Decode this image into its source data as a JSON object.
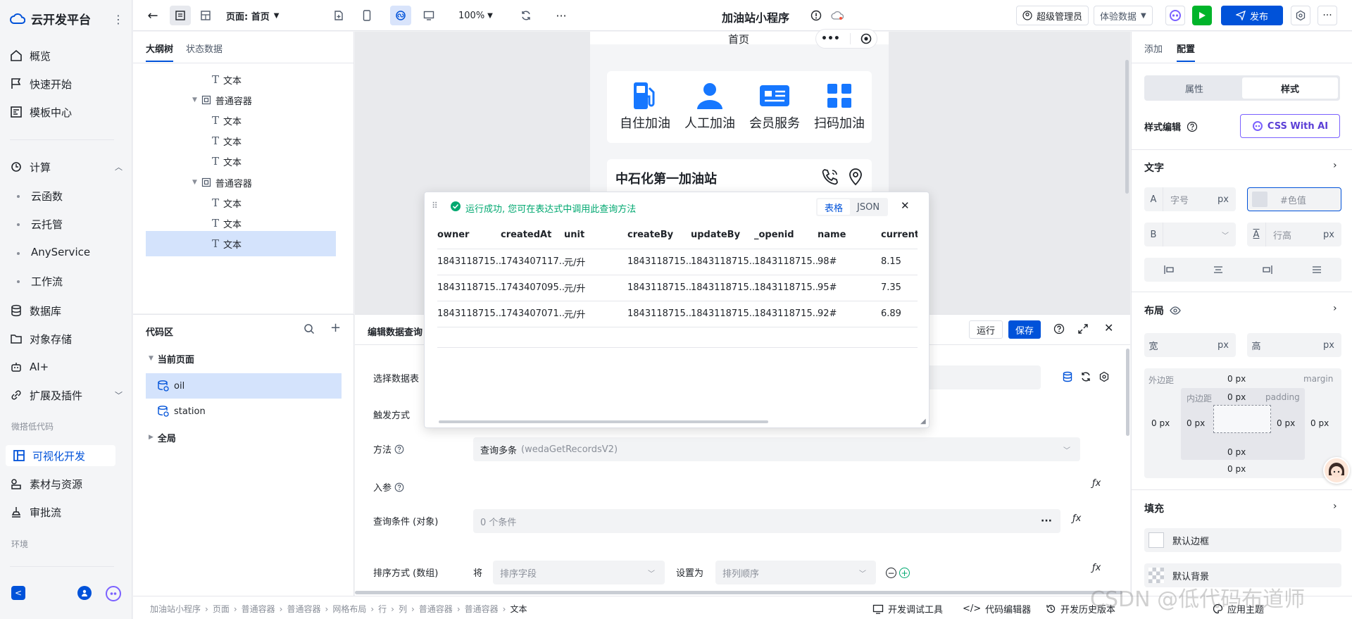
{
  "app": {
    "name": "云开发平台",
    "page_title": "加油站小程序"
  },
  "nav": {
    "items": [
      "概览",
      "快速开始",
      "模板中心"
    ],
    "compute": "计算",
    "compute_sub": [
      "云函数",
      "云托管",
      "AnyService",
      "工作流"
    ],
    "items2": [
      "数据库",
      "对象存储",
      "AI+",
      "扩展及插件"
    ],
    "group_lowcode": "微搭低代码",
    "active": "可视化开发",
    "items3": [
      "素材与资源",
      "审批流"
    ],
    "group_env": "环境"
  },
  "topbar": {
    "page_label": "页面: 首页",
    "zoom": "100%",
    "user": "超级管理员",
    "env": "体验数据",
    "publish": "发布"
  },
  "tree": {
    "tabs": [
      "大纲树",
      "状态数据"
    ],
    "nodes": [
      {
        "label": "文本",
        "type": "text",
        "level": 2
      },
      {
        "label": "普通容器",
        "type": "container",
        "level": 1
      },
      {
        "label": "文本",
        "type": "text",
        "level": 2
      },
      {
        "label": "文本",
        "type": "text",
        "level": 2
      },
      {
        "label": "文本",
        "type": "text",
        "level": 2
      },
      {
        "label": "普通容器",
        "type": "container",
        "level": 1
      },
      {
        "label": "文本",
        "type": "text",
        "level": 2
      },
      {
        "label": "文本",
        "type": "text",
        "level": 2
      },
      {
        "label": "文本",
        "type": "text",
        "level": 2,
        "selected": true
      }
    ]
  },
  "code": {
    "title": "代码区",
    "current_page": "当前页面",
    "items": [
      "oil",
      "station"
    ],
    "global": "全局"
  },
  "phone": {
    "header": "首页",
    "services": [
      "自住加油",
      "人工加油",
      "会员服务",
      "扫码加油"
    ],
    "station_name": "中石化第一加油站"
  },
  "editor": {
    "title": "编辑数据查询",
    "run": "运行",
    "save": "保存",
    "fields": {
      "select_table": "选择数据表",
      "trigger": "触发方式",
      "method": "方法",
      "method_value": "查询多条",
      "method_api": "(wedaGetRecordsV2)",
      "params": "入参",
      "query_cond": "查询条件 (对象)",
      "query_cond_value": "0 个条件",
      "sort": "排序方式 (数组)",
      "sort_will": "将",
      "sort_field_ph": "排序字段",
      "sort_set_as": "设置为",
      "sort_order_ph": "排列顺序"
    }
  },
  "popup": {
    "message": "运行成功, 您可在表达式中调用此查询方法",
    "tabs": [
      "表格",
      "JSON"
    ],
    "columns": [
      "owner",
      "createdAt",
      "unit",
      "createBy",
      "updateBy",
      "_openid",
      "name",
      "current_"
    ],
    "rows": [
      [
        "1843118715...",
        "1743407117...",
        "元/升",
        "1843118715...",
        "1843118715...",
        "1843118715...",
        "98#",
        "8.15"
      ],
      [
        "1843118715...",
        "1743407095...",
        "元/升",
        "1843118715...",
        "1843118715...",
        "1843118715...",
        "95#",
        "7.35"
      ],
      [
        "1843118715...",
        "1743407071...",
        "元/升",
        "1843118715...",
        "1843118715...",
        "1843118715...",
        "92#",
        "6.89"
      ]
    ]
  },
  "right": {
    "tabs": [
      "添加",
      "配置"
    ],
    "seg": [
      "属性",
      "样式"
    ],
    "style_edit": "样式编辑",
    "css_ai": "CSS With AI",
    "text_section": "文字",
    "font_size_ph": "字号",
    "px": "px",
    "color_ph": "#色值",
    "line_height_ph": "行高",
    "layout_section": "布局",
    "width": "宽",
    "height": "高",
    "outer_margin": "外边距",
    "margin": "margin",
    "inner_padding": "内边距",
    "padding": "padding",
    "zero": "0 px",
    "fill_section": "填充",
    "default_border": "默认边框",
    "default_bg": "默认背景"
  },
  "status": {
    "breadcrumb": [
      "加油站小程序",
      "页面",
      "普通容器",
      "普通容器",
      "网格布局",
      "行",
      "列",
      "普通容器",
      "普通容器",
      "文本"
    ],
    "tools": [
      "开发调试工具",
      "代码编辑器",
      "开发历史版本",
      "应用主题"
    ]
  },
  "watermark": "CSDN @低代码布道师",
  "colors": {
    "accent": "#0052d9",
    "green": "#00a870",
    "selected_bg": "#d4e3fc",
    "run_btn": "#00b42a"
  }
}
